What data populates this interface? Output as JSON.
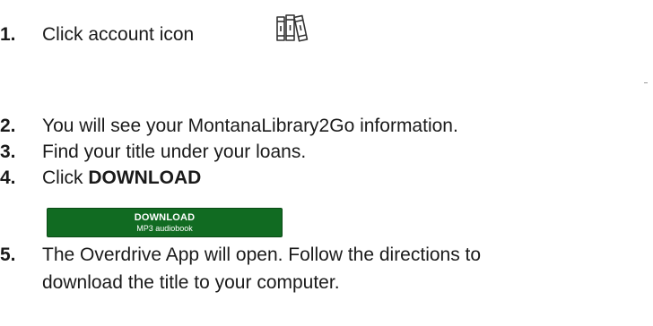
{
  "steps": [
    {
      "number": "1.",
      "text": "Click account icon"
    },
    {
      "number": "2.",
      "text": "You will see your MontanaLibrary2Go information."
    },
    {
      "number": "3.",
      "text": "Find your title under your loans."
    },
    {
      "number": "4.",
      "text_prefix": "Click ",
      "text_bold": "DOWNLOAD"
    },
    {
      "number": "5.",
      "text": "The Overdrive App will open.  Follow the directions to",
      "text_continued": "download the title to your computer."
    }
  ],
  "account_icon": {
    "icon": "books-icon"
  },
  "download_button": {
    "label": "DOWNLOAD",
    "sublabel": "MP3 audiobook",
    "background_color": "#116b22",
    "text_color": "#ffffff"
  }
}
